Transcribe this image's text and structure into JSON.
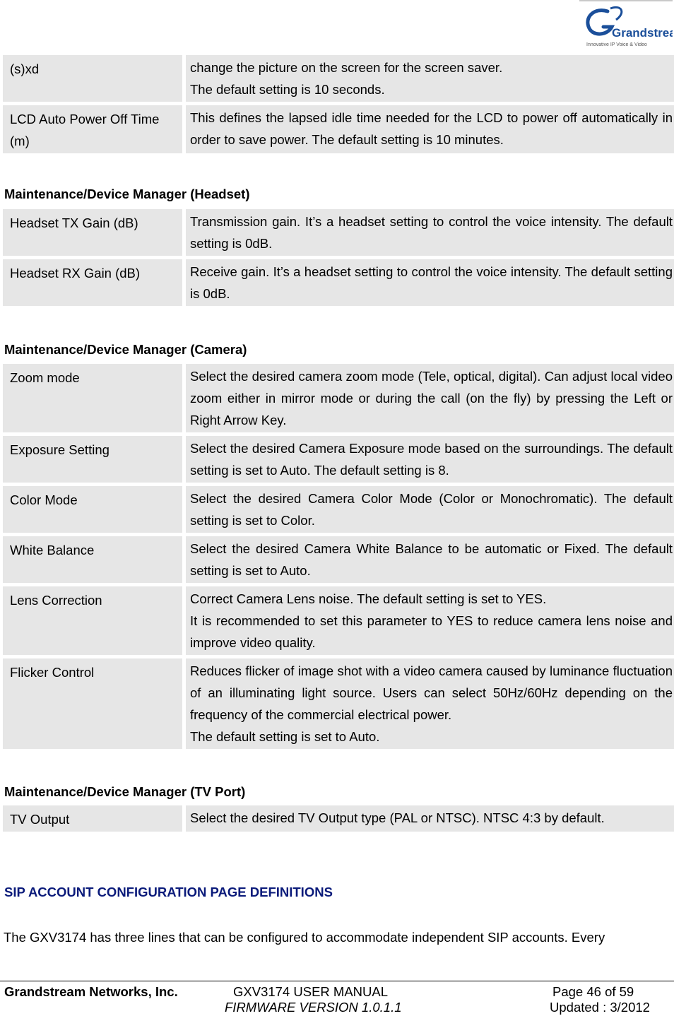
{
  "header": {
    "logo": {
      "brand": "Grandstream",
      "tagline": "Innovative IP Voice & Video",
      "icon": "grandstream-logo-icon",
      "color": "#1b4f9a"
    }
  },
  "tables": {
    "screen": {
      "rows": [
        {
          "name": "(s)xd",
          "desc": [
            "change the picture on the screen for the screen saver.",
            "The default setting is 10 seconds."
          ]
        },
        {
          "name": "LCD Auto Power Off Time (m)",
          "desc": [
            "This defines the lapsed idle time needed for the LCD to power off automatically in order to save power. The default setting is 10 minutes."
          ]
        }
      ]
    },
    "headset": {
      "heading": "Maintenance/Device Manager (Headset)",
      "rows": [
        {
          "name": "Headset TX Gain (dB)",
          "desc": [
            "Transmission gain. It’s a headset setting to control the voice intensity. The default setting is 0dB."
          ]
        },
        {
          "name": "Headset RX Gain (dB)",
          "desc": [
            "Receive gain. It’s a headset setting to control the voice intensity. The default setting is 0dB."
          ]
        }
      ]
    },
    "camera": {
      "heading": "Maintenance/Device Manager (Camera)",
      "rows": [
        {
          "name": "Zoom mode",
          "desc": [
            "Select the desired camera zoom mode (Tele, optical, digital). Can adjust local video zoom either in mirror mode or during the call (on the fly) by pressing the Left or Right Arrow Key."
          ]
        },
        {
          "name": "Exposure Setting",
          "desc": [
            "Select the desired Camera Exposure mode based on the surroundings. The default setting is set to Auto. The default setting is 8."
          ]
        },
        {
          "name": "Color Mode",
          "desc": [
            "Select the desired Camera Color Mode (Color or Monochromatic). The default setting is set to Color."
          ]
        },
        {
          "name": "White Balance",
          "desc": [
            "Select the desired Camera White Balance to be automatic or Fixed. The default setting is set to Auto."
          ]
        },
        {
          "name": "Lens Correction",
          "desc": [
            "Correct Camera Lens noise. The default setting is set to YES.",
            "It is recommended to set this parameter to YES to reduce camera lens noise and improve video quality."
          ]
        },
        {
          "name": "Flicker Control",
          "desc": [
            "Reduces flicker of image shot with a video camera caused by luminance fluctuation of an illuminating light source. Users can select 50Hz/60Hz depending on the frequency of the commercial electrical power.",
            "The default setting is set to Auto."
          ]
        }
      ]
    },
    "tvport": {
      "heading": "Maintenance/Device Manager (TV Port)",
      "rows": [
        {
          "name": "TV Output",
          "desc": [
            "Select the desired TV Output type (PAL or NTSC). NTSC 4:3 by default."
          ]
        }
      ]
    }
  },
  "sip": {
    "heading": "SIP ACCOUNT CONFIGURATION PAGE DEFINITIONS",
    "heading_color": "#0a1a7a",
    "body": "The GXV3174 has three lines that can be configured to accommodate independent SIP accounts. Every"
  },
  "footer": {
    "company": "Grandstream Networks, Inc.",
    "manual": "GXV3174 USER MANUAL",
    "firmware": "FIRMWARE VERSION 1.0.1.1",
    "page": "Page 46 of 59",
    "updated": "Updated : 3/2012"
  }
}
